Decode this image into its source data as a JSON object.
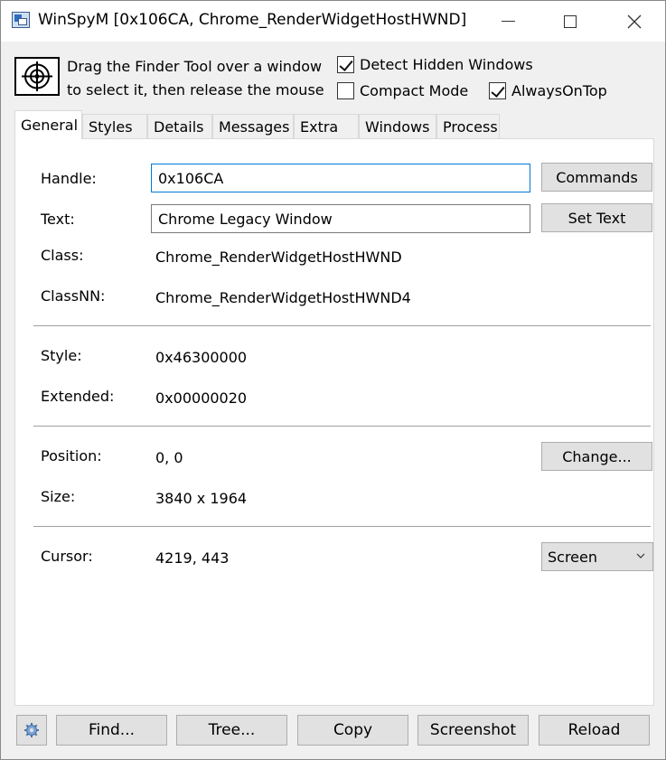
{
  "window": {
    "title": "WinSpyM [0x106CA, Chrome_RenderWidgetHostHWND]"
  },
  "finder": {
    "instructions_line1": "Drag the Finder Tool over a window",
    "instructions_line2": "to select it, then release the mouse"
  },
  "options": {
    "detect_hidden": {
      "label": "Detect Hidden Windows",
      "checked": true
    },
    "compact_mode": {
      "label": "Compact Mode",
      "checked": false
    },
    "always_on_top": {
      "label": "AlwaysOnTop",
      "checked": true
    }
  },
  "tabs": [
    {
      "label": "General",
      "active": true
    },
    {
      "label": "Styles"
    },
    {
      "label": "Details"
    },
    {
      "label": "Messages"
    },
    {
      "label": "Extra"
    },
    {
      "label": "Windows"
    },
    {
      "label": "Process"
    }
  ],
  "general": {
    "handle_label": "Handle:",
    "handle_value": "0x106CA",
    "commands_label": "Commands",
    "text_label": "Text:",
    "text_value": "Chrome Legacy Window",
    "set_text_label": "Set Text",
    "class_label": "Class:",
    "class_value": "Chrome_RenderWidgetHostHWND",
    "classnn_label": "ClassNN:",
    "classnn_value": "Chrome_RenderWidgetHostHWND4",
    "style_label": "Style:",
    "style_value": "0x46300000",
    "extended_label": "Extended:",
    "extended_value": "0x00000020",
    "position_label": "Position:",
    "position_value": "0, 0",
    "change_label": "Change...",
    "size_label": "Size:",
    "size_value": "3840 x 1964",
    "cursor_label": "Cursor:",
    "cursor_value": "4219, 443",
    "cursor_mode": "Screen"
  },
  "bottom": {
    "find": "Find...",
    "tree": "Tree...",
    "copy": "Copy",
    "screenshot": "Screenshot",
    "reload": "Reload"
  }
}
